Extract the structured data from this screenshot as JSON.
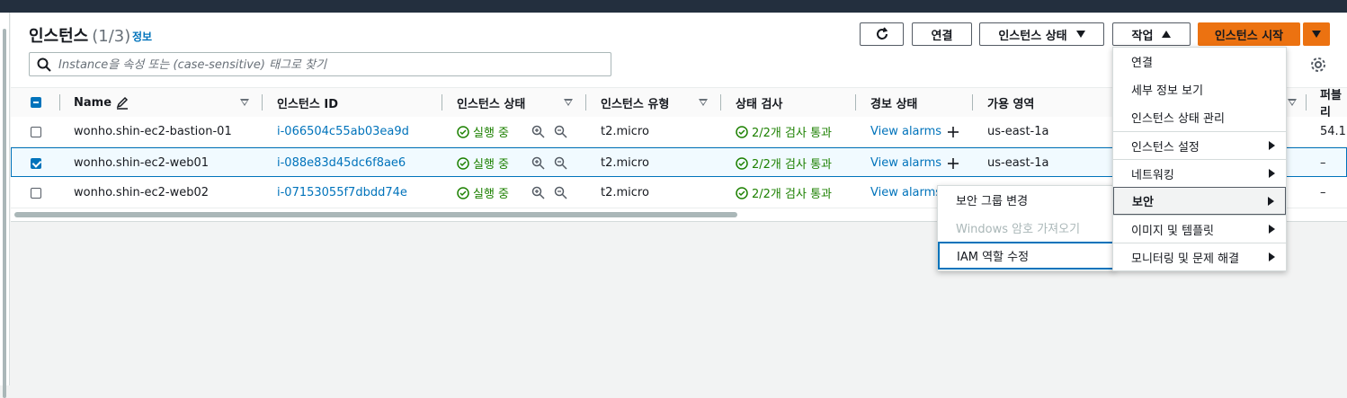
{
  "header": {
    "title": "인스턴스",
    "count": "(1/3)",
    "info": "정보",
    "refresh_icon": "refresh-icon",
    "connect_label": "연결",
    "instance_state_label": "인스턴스 상태",
    "actions_label": "작업",
    "launch_label": "인스턴스 시작"
  },
  "search": {
    "placeholder": "Instance을 속성 또는 (case-sensitive) 태그로 찾기"
  },
  "table": {
    "columns": {
      "name": "Name",
      "instance_id": "인스턴스 ID",
      "state": "인스턴스 상태",
      "type": "인스턴스 유형",
      "status_check": "상태 검사",
      "alarm": "경보 상태",
      "az": "가용 영역",
      "public": "퍼블리"
    },
    "rows": [
      {
        "name": "wonho.shin-ec2-bastion-01",
        "id": "i-066504c55ab03ea9d",
        "state": "실행 중",
        "type": "t2.micro",
        "check": "2/2개 검사 통과",
        "alarm": "View alarms",
        "az": "us-east-1a",
        "public": "54.1",
        "selected": false
      },
      {
        "name": "wonho.shin-ec2-web01",
        "id": "i-088e83d45dc6f8ae6",
        "state": "실행 중",
        "type": "t2.micro",
        "check": "2/2개 검사 통과",
        "alarm": "View alarms",
        "az": "us-east-1a",
        "public": "–",
        "selected": true
      },
      {
        "name": "wonho.shin-ec2-web02",
        "id": "i-07153055f7dbdd74e",
        "state": "실행 중",
        "type": "t2.micro",
        "check": "2/2개 검사 통과",
        "alarm": "View alarms",
        "az": "",
        "public": "–",
        "selected": false
      }
    ]
  },
  "actions_menu": {
    "items": [
      "연결",
      "세부 정보 보기",
      "인스턴스 상태 관리",
      "인스턴스 설정",
      "네트워킹",
      "보안",
      "이미지 및 템플릿",
      "모니터링 및 문제 해결"
    ]
  },
  "security_submenu": {
    "items": [
      "보안 그룹 변경",
      "Windows 암호 가져오기",
      "IAM 역할 수정"
    ]
  },
  "colors": {
    "accent": "#0073bb",
    "primary": "#ec7211",
    "success": "#1d8102",
    "nav": "#232f3e"
  }
}
